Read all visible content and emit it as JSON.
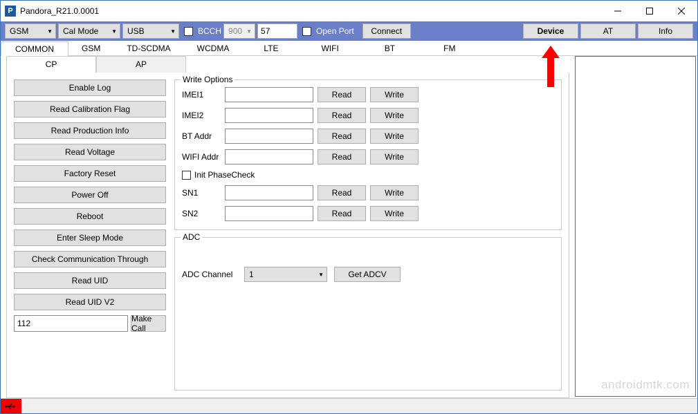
{
  "window": {
    "title": "Pandora_R21.0.0001"
  },
  "toolbar": {
    "dd_mode": "GSM",
    "dd_cal": "Cal Mode",
    "dd_conn": "USB",
    "bcch_label": "BCCH",
    "bcch_band": "900",
    "bcch_ch": "57",
    "open_port_label": "Open Port",
    "connect_label": "Connect",
    "device_label": "Device",
    "at_label": "AT",
    "info_label": "Info"
  },
  "tabs": {
    "items": [
      "COMMON",
      "GSM",
      "TD-SCDMA",
      "WCDMA",
      "LTE",
      "WIFI",
      "BT",
      "FM"
    ]
  },
  "subtabs": {
    "cp": "CP",
    "ap": "AP"
  },
  "actions": {
    "enable_log": "Enable Log",
    "read_cal_flag": "Read Calibration Flag",
    "read_prod_info": "Read Production Info",
    "read_voltage": "Read Voltage",
    "factory_reset": "Factory Reset",
    "power_off": "Power Off",
    "reboot": "Reboot",
    "enter_sleep": "Enter Sleep Mode",
    "check_comm": "Check Communication Through",
    "read_uid": "Read UID",
    "read_uid_v2": "Read UID V2",
    "call_number": "112",
    "make_call": "Make Call"
  },
  "write_options": {
    "legend": "Write Options",
    "imei1": "IMEI1",
    "imei2": "IMEI2",
    "bt_addr": "BT Addr",
    "wifi_addr": "WIFI Addr",
    "init_phasecheck": "Init PhaseCheck",
    "sn1": "SN1",
    "sn2": "SN2",
    "read": "Read",
    "write": "Write"
  },
  "adc": {
    "legend": "ADC",
    "channel_label": "ADC Channel",
    "channel_value": "1",
    "get_label": "Get ADCV"
  },
  "watermark": "androidmtk.com"
}
